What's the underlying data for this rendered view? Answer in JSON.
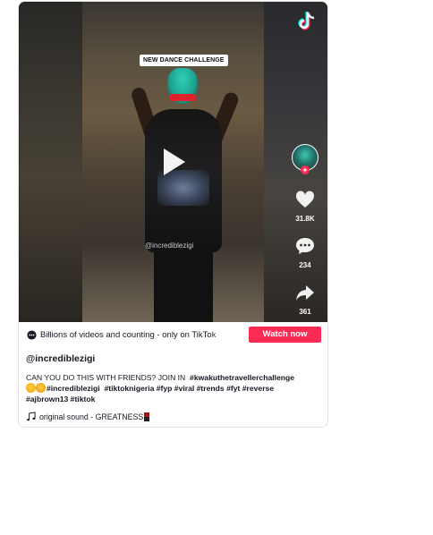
{
  "video": {
    "overlay_title": "NEW DANCE CHALLENGE",
    "watermark": "@incrediblezigi",
    "logo_icon": "tiktok-logo-icon",
    "play_icon": "play-icon"
  },
  "rail": {
    "avatar_icon": "creator-avatar",
    "follow_icon": "plus-icon",
    "likes": "31.8K",
    "comments": "234",
    "shares": "361"
  },
  "promo": {
    "text": "Billions of videos and counting - only on TikTok",
    "button": "Watch now"
  },
  "meta": {
    "username": "@incrediblezigi",
    "caption_plain": "CAN YOU DO THIS WITH FRIENDS? JOIN IN",
    "tag1": "#kwakuthetravellerchallenge",
    "tag2": "#incrediblezigi",
    "tags_line": "#tiktoknigeria #fyp #viral #trends #fyt #reverse",
    "tags_line3": "#ajbrown13 #tiktok",
    "sound": "original sound - GREATNESS"
  },
  "colors": {
    "accent": "#fe2c55",
    "text": "#161823"
  }
}
